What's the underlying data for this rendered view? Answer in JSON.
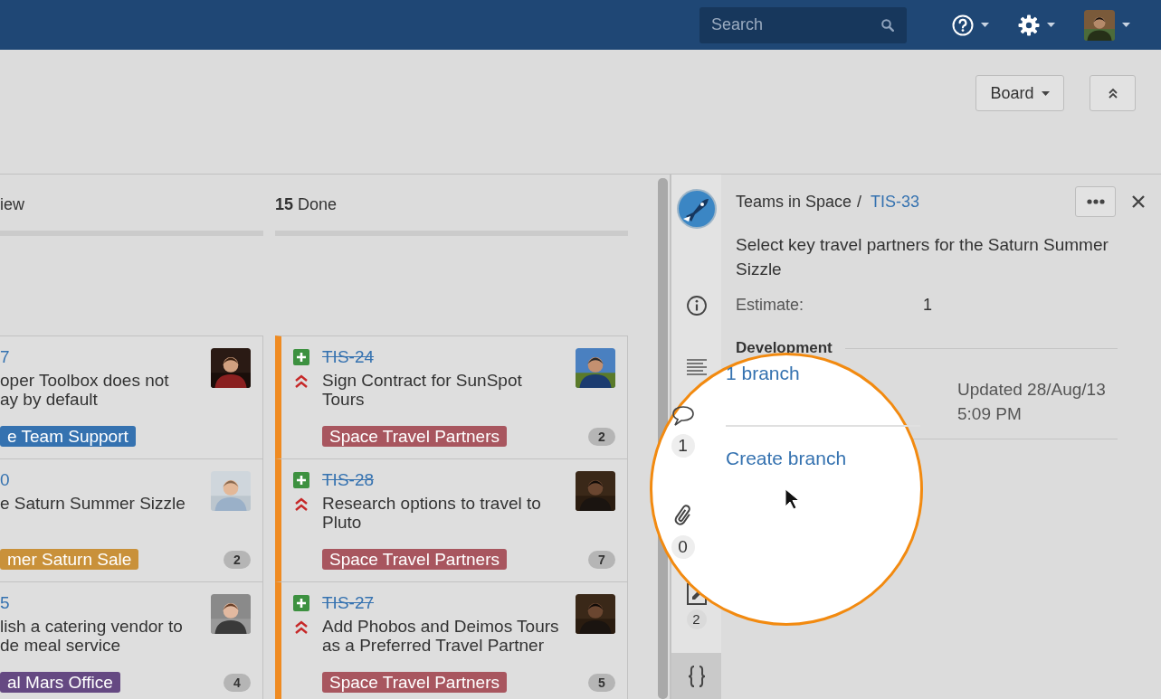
{
  "topbar": {
    "search": {
      "placeholder": "Search"
    },
    "menus": [
      {
        "kind": "help"
      },
      {
        "kind": "settings"
      },
      {
        "kind": "profile",
        "avatar": {
          "kind": "picture"
        }
      }
    ]
  },
  "toolbar": {
    "buttons": [
      {
        "kind": "dropdown",
        "label": "Board"
      },
      {
        "kind": "collapse"
      }
    ]
  },
  "columns": [
    {
      "title": "iew",
      "kind": "partial",
      "cards": [
        {
          "key": "7",
          "resolved": false,
          "summary_lines": [
            "oper Toolbox does not",
            "ay by default"
          ],
          "label": {
            "text": "e Team Support",
            "color": "#3572b0"
          },
          "avatar": {
            "kind": "picture"
          }
        },
        {
          "key": "0",
          "resolved": false,
          "summary_lines": [
            "e Saturn Summer Sizzle"
          ],
          "label": {
            "text": "mer Saturn Sale",
            "color": "#c9913a"
          },
          "estimate": "2",
          "avatar": {
            "kind": "picture"
          }
        },
        {
          "key": "5",
          "resolved": false,
          "summary_lines": [
            "lish a catering vendor to",
            "de meal service"
          ],
          "label": {
            "text": "al Mars Office",
            "color": "#654982"
          },
          "estimate": "4",
          "avatar": {
            "kind": "picture"
          }
        }
      ]
    },
    {
      "title": "**15** Done",
      "kind": "full",
      "cards": [
        {
          "key": "TIS-24",
          "resolved": true,
          "icons": [
            {
              "kind": "new-feature"
            },
            {
              "kind": "highest-priority"
            }
          ],
          "summary_lines": [
            "Sign Contract for SunSpot Tours"
          ],
          "label": {
            "text": "Space Travel Partners",
            "color": "#a8565f"
          },
          "estimate": "2",
          "avatar": {
            "kind": "picture"
          }
        },
        {
          "key": "TIS-28",
          "resolved": true,
          "icons": [
            {
              "kind": "new-feature"
            },
            {
              "kind": "highest-priority"
            }
          ],
          "summary_lines": [
            "Research options to travel to Pluto"
          ],
          "label": {
            "text": "Space Travel Partners",
            "color": "#a8565f"
          },
          "estimate": "7",
          "avatar": {
            "kind": "picture"
          }
        },
        {
          "key": "TIS-27",
          "resolved": true,
          "icons": [
            {
              "kind": "new-feature"
            },
            {
              "kind": "highest-priority"
            }
          ],
          "summary_lines": [
            "Add Phobos and Deimos Tours as a Preferred Travel Partner"
          ],
          "label": {
            "text": "Space Travel Partners",
            "color": "#a8565f"
          },
          "estimate": "5",
          "avatar": {
            "kind": "picture"
          }
        }
      ]
    }
  ],
  "panel": {
    "breadcrumb": [
      "Teams in Space",
      "TIS-33"
    ],
    "breadcrumb_separator": "/",
    "summary": "Select key travel partners for the Saturn Summer Sizzle",
    "fields": [
      {
        "label": "Estimate:",
        "value": "1"
      }
    ],
    "development": {
      "title": "Development",
      "updated_lines": [
        "Updated 28/Aug/13",
        "5:09 PM"
      ]
    },
    "tabs": [
      {
        "kind": "project",
        "selected": false
      },
      {
        "kind": "info",
        "selected": false
      },
      {
        "kind": "description",
        "selected": false
      },
      {
        "kind": "subtasks",
        "count": "2",
        "selected": false
      },
      {
        "kind": "development",
        "selected": true
      }
    ]
  },
  "magnifier": {
    "tabs": [
      {
        "kind": "comments",
        "count": "1"
      },
      {
        "kind": "attachments",
        "count": "0"
      }
    ],
    "branches": "1 branch",
    "action": "Create branch",
    "cursor": true
  }
}
